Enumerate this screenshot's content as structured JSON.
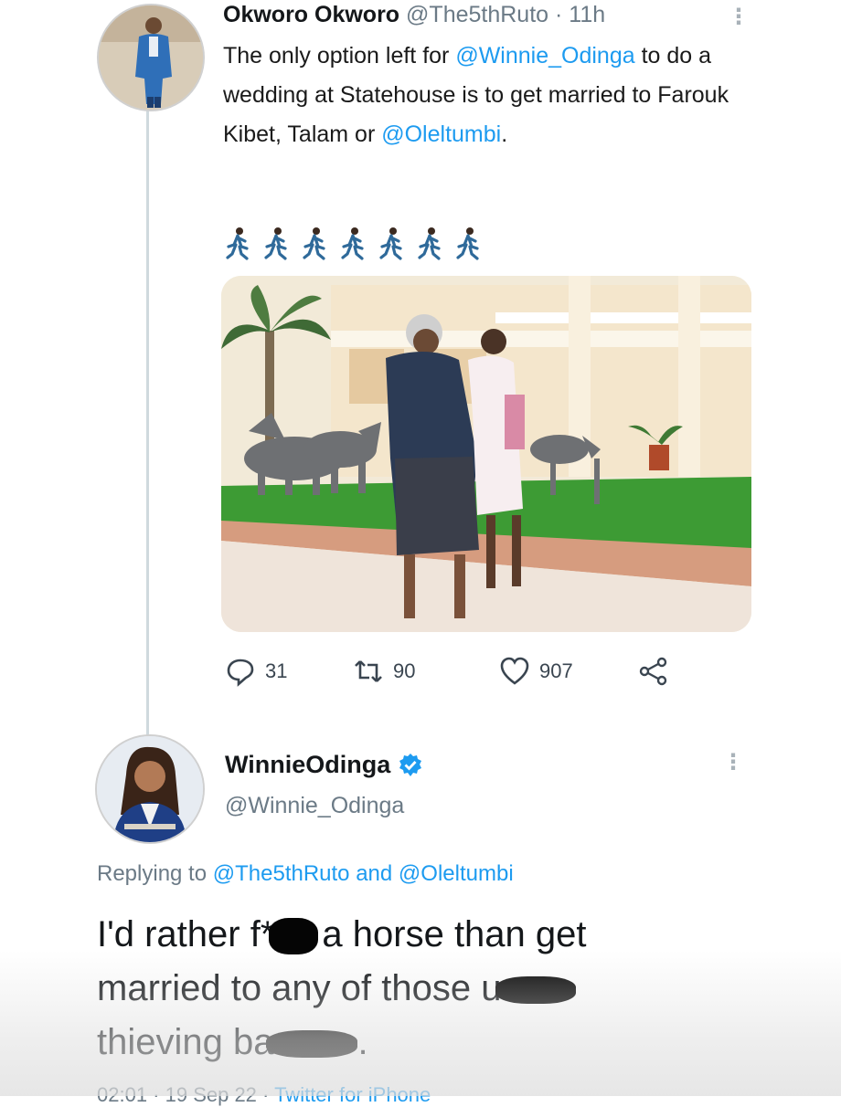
{
  "tweet1": {
    "name": "Okworo Okworo",
    "handle": "@The5thRuto",
    "separator": " · ",
    "time": "11h",
    "text_part1": "The only option left for ",
    "mention1": "@Winnie_Odinga",
    "text_part2": " to do a wedding at Statehouse is to get married to Farouk Kibet, Talam or ",
    "mention2": "@Oleltumbi",
    "text_part3": ".",
    "emoji": [
      "person-running-icon",
      "person-running-icon",
      "person-running-icon",
      "person-running-icon",
      "person-running-icon",
      "person-running-icon",
      "person-running-icon"
    ],
    "stats": {
      "replies": "31",
      "retweets": "90",
      "likes": "907"
    }
  },
  "tweet2": {
    "name": "WinnieOdinga",
    "handle": "@Winnie_Odinga",
    "replying_prefix": "Replying to ",
    "replying_to1": "@The5thRuto",
    "replying_and": " and ",
    "replying_to2": "@Oleltumbi",
    "line1_a": "I'd rather f*",
    "line1_b": "a horse than get",
    "line2_a": "married to any of those u",
    "line3_a": "thieving ba",
    "line3_b": ".",
    "meta_time": "02:01 · 19 Sep 22 · ",
    "meta_app": "Twitter for iPhone"
  },
  "colors": {
    "link": "#1d9bf0",
    "secondary_text": "#6b7a86",
    "verified": "#1d9bf0"
  }
}
